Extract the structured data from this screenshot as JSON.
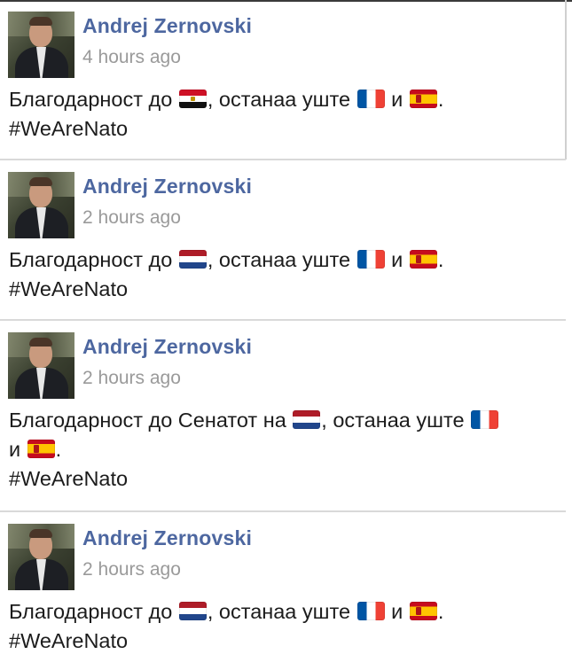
{
  "posts": [
    {
      "author": "Andrej Zernovski",
      "time": "4 hours ago",
      "line1_prefix": "Благодарност до",
      "line1_mid": ", останаа уште",
      "line1_conj": "и",
      "line1_end": ".",
      "hashtag": "#WeAreNato",
      "flags": [
        "flag-egypt-icon",
        "flag-france-icon",
        "flag-spain-icon"
      ]
    },
    {
      "author": "Andrej Zernovski",
      "time": "2 hours ago",
      "line1_prefix": "Благодарност до",
      "line1_mid": ", останаа уште",
      "line1_conj": "и",
      "line1_end": ".",
      "hashtag": "#WeAreNato",
      "flags": [
        "flag-netherlands-icon",
        "flag-france-icon",
        "flag-spain-icon"
      ]
    },
    {
      "author": "Andrej Zernovski",
      "time": "2 hours ago",
      "line1_prefix": "Благодарност до Сенатот на",
      "line1_mid": ", останаа уште",
      "line2_prefix": "и",
      "line2_end": ".",
      "hashtag": "#WeAreNato",
      "flags": [
        "flag-netherlands-icon",
        "flag-france-icon",
        "flag-spain-icon"
      ]
    },
    {
      "author": "Andrej Zernovski",
      "time": "2 hours ago",
      "line1_prefix": "Благодарност до",
      "line1_mid": ", останаа уште",
      "line1_conj": "и",
      "line1_end": ".",
      "hashtag": "#WeAreNato",
      "flags": [
        "flag-netherlands-icon",
        "flag-france-icon",
        "flag-spain-icon"
      ]
    }
  ],
  "colors": {
    "author_name": "#4d67a0",
    "timestamp": "#9a9a9a",
    "body_text": "#1c1c1c",
    "divider": "#d9d9d9"
  }
}
